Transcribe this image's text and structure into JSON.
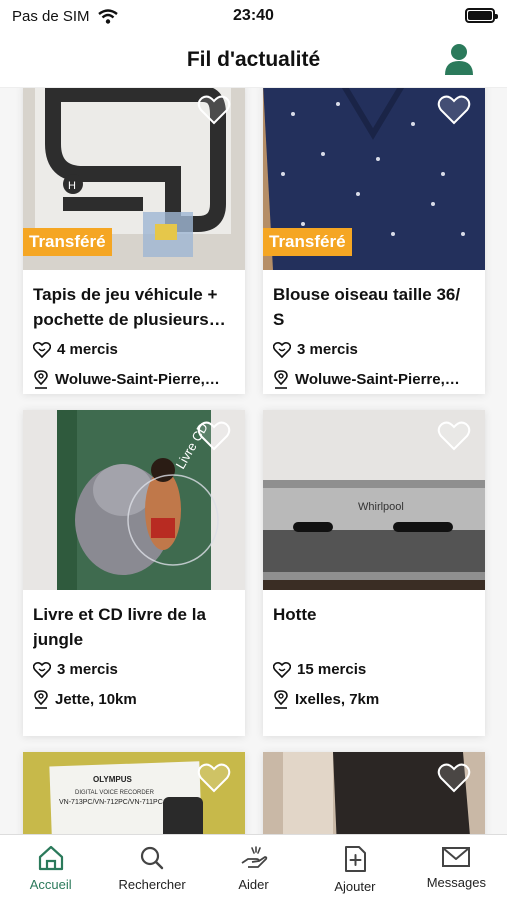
{
  "status_bar": {
    "carrier": "Pas de SIM",
    "time": "23:40"
  },
  "header": {
    "title": "Fil d'actualité"
  },
  "badge_label": "Transféré",
  "items": [
    {
      "title": "Tapis de jeu véhicule + pochette de plusieurs…",
      "thanks": "4 mercis",
      "location": "Woluwe-Saint-Pierre,…",
      "transferred": true
    },
    {
      "title": "Blouse oiseau taille 36/ S",
      "thanks": "3 mercis",
      "location": "Woluwe-Saint-Pierre,…",
      "transferred": true
    },
    {
      "title": "Livre et  CD livre de la jungle",
      "thanks": "3 mercis",
      "location": "Jette, 10km",
      "transferred": false
    },
    {
      "title": "Hotte",
      "thanks": "15 mercis",
      "location": "Ixelles, 7km",
      "transferred": false
    }
  ],
  "photo_text": {
    "olympus_brand": "OLYMPUS",
    "olympus_line1": "DIGITAL VOICE RECORDER",
    "olympus_line2": "VN-713PC/VN-712PC/VN-711PC",
    "jungle_cd": "Livre CD",
    "whirlpool": "Whirlpool"
  },
  "tabs": [
    {
      "label": "Accueil",
      "icon": "home-icon",
      "active": true
    },
    {
      "label": "Rechercher",
      "icon": "search-icon",
      "active": false
    },
    {
      "label": "Aider",
      "icon": "helping-hand-icon",
      "active": false
    },
    {
      "label": "Ajouter",
      "icon": "add-document-icon",
      "active": false
    },
    {
      "label": "Messages",
      "icon": "envelope-icon",
      "active": false
    }
  ],
  "colors": {
    "accent": "#2b7a5b",
    "badge": "#f5a623",
    "text": "#111111"
  }
}
